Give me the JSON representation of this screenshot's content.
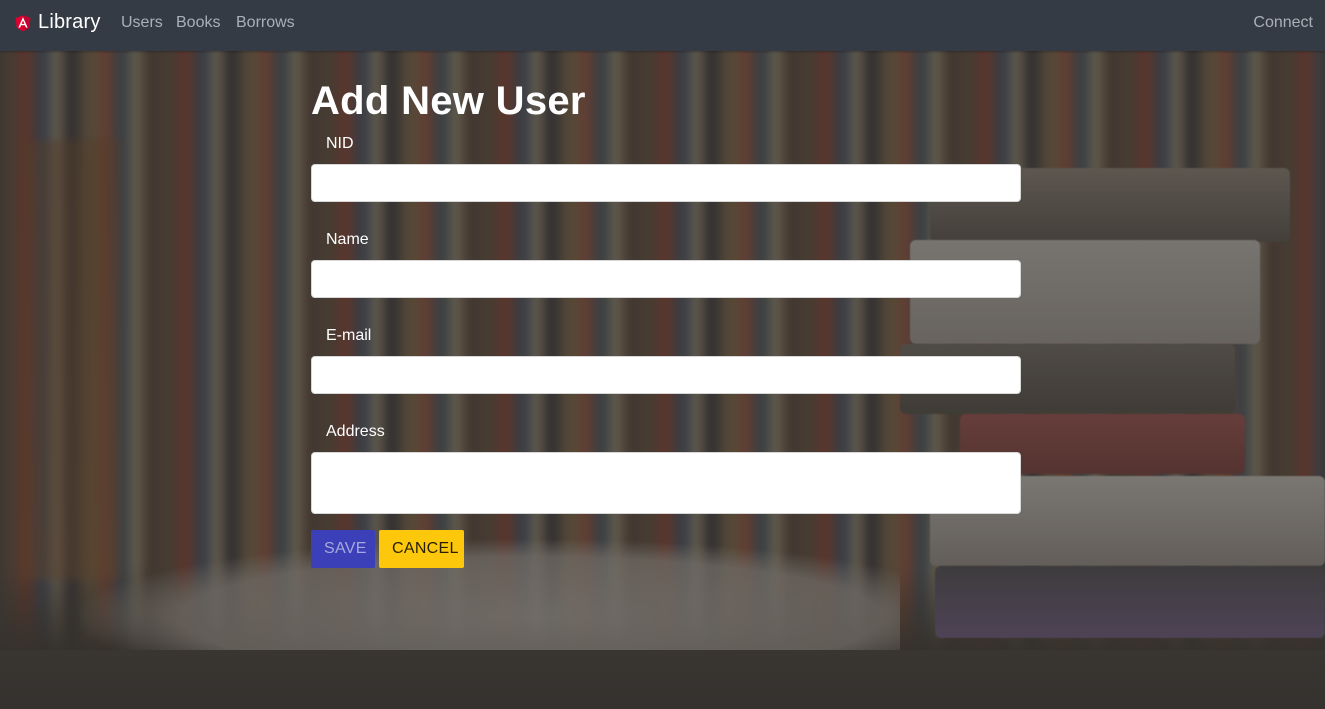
{
  "navbar": {
    "brand_label": "Library",
    "brand_icon": "angular-logo-icon",
    "links": [
      {
        "label": "Users"
      },
      {
        "label": "Books"
      },
      {
        "label": "Borrows"
      }
    ],
    "connect_label": "Connect"
  },
  "form": {
    "title": "Add New User",
    "fields": {
      "nid": {
        "label": "NID",
        "value": ""
      },
      "name": {
        "label": "Name",
        "value": ""
      },
      "email": {
        "label": "E-mail",
        "value": ""
      },
      "address": {
        "label": "Address",
        "value": ""
      }
    },
    "save_label": "SAVE",
    "cancel_label": "CANCEL"
  },
  "colors": {
    "navbar_bg": "#353b45",
    "save_button": "#3b3fb8",
    "cancel_button": "#fdc80c",
    "brand_icon": "#dd0031"
  }
}
